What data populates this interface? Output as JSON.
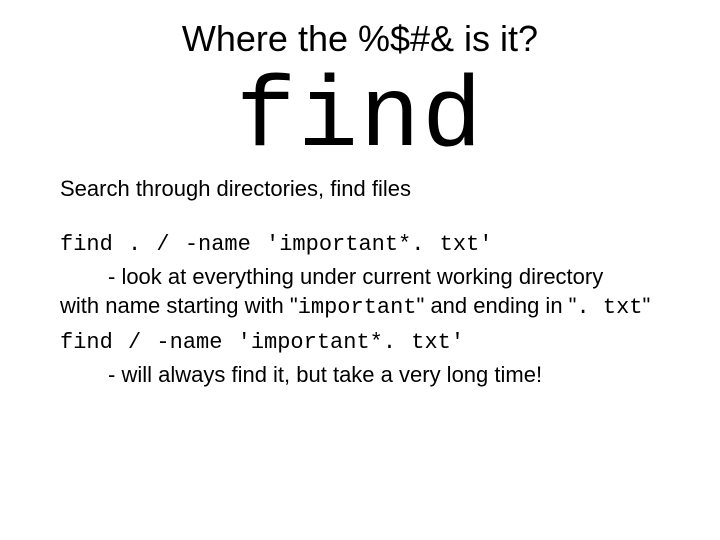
{
  "title": "Where the %$#& is it?",
  "command": "find",
  "subtitle": "Search through directories, find files",
  "ex1": "find . / -name 'important*. txt'",
  "desc1a": "- look at everything under current working directory",
  "desc1b_pre": "with name starting with \"",
  "desc1b_mono1": "important",
  "desc1b_mid": "\" and ending in \"",
  "desc1b_mono2": ". txt",
  "desc1b_post": "\"",
  "ex2": "find / -name 'important*. txt'",
  "desc2": "- will always find it, but take a very long time!"
}
